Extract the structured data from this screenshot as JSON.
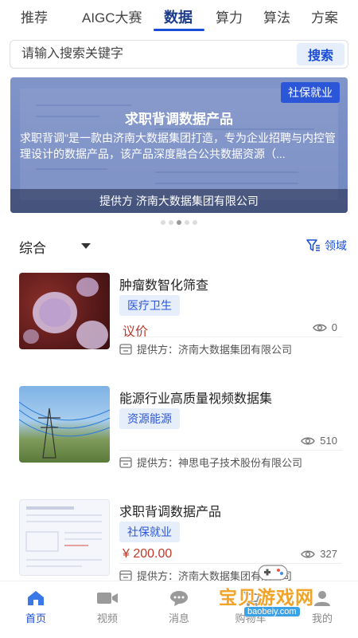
{
  "tabs": [
    {
      "label": "推荐",
      "active": false
    },
    {
      "label": "AIGC大赛",
      "active": false
    },
    {
      "label": "数据",
      "active": true
    },
    {
      "label": "算力",
      "active": false
    },
    {
      "label": "算法",
      "active": false
    },
    {
      "label": "方案",
      "active": false
    }
  ],
  "search": {
    "placeholder": "请输入搜索关键字",
    "button_label": "搜索"
  },
  "banner": {
    "tag": "社保就业",
    "title": "求职背调数据产品",
    "description": "求职背调\"是一款由济南大数据集团打造，专为企业招聘与内控管理设计的数据产品，该产品深度融合公共数据资源（...",
    "provider": "提供方   济南大数据集团有限公司",
    "dots_total": 5,
    "dots_active_index": 2
  },
  "sort": {
    "label": "综合"
  },
  "filter": {
    "label": "领域",
    "icon": "funnel-icon"
  },
  "products": [
    {
      "title": "肿瘤数智化筛查",
      "tag": "医疗卫生",
      "price": "议价",
      "views": "0",
      "provider": "提供方：济南大数据集团有限公司",
      "thumb": "cells"
    },
    {
      "title": "能源行业高质量视频数据集",
      "tag": "资源能源",
      "price": "",
      "views": "510",
      "provider": "提供方：神思电子技术股份有限公司",
      "thumb": "powerline"
    },
    {
      "title": "求职背调数据产品",
      "tag": "社保就业",
      "price": "¥ 200.00",
      "views": "327",
      "provider": "提供方：济南大数据集团有限公司",
      "thumb": "document"
    }
  ],
  "bottom_nav": [
    {
      "label": "首页",
      "icon": "home-icon",
      "active": true
    },
    {
      "label": "视频",
      "icon": "video-icon",
      "active": false
    },
    {
      "label": "消息",
      "icon": "message-icon",
      "active": false
    },
    {
      "label": "购物车",
      "icon": "cart-icon",
      "active": false
    },
    {
      "label": "我的",
      "icon": "profile-icon",
      "active": false
    }
  ],
  "watermark": {
    "text": "宝贝游戏网",
    "url": "baobeiy.com"
  },
  "colors": {
    "accent": "#1a4dd6",
    "price": "#c0392b",
    "tag_bg": "#e6eefb"
  }
}
